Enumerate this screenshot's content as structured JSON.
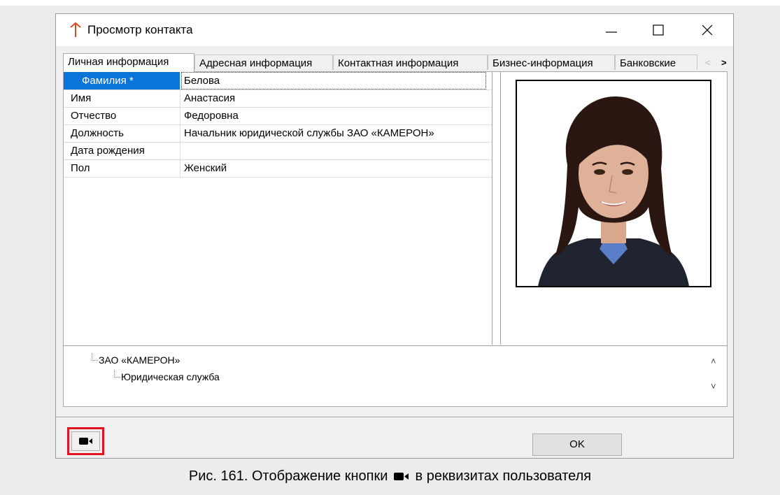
{
  "window": {
    "title": "Просмотр контакта",
    "accent_color": "#d84b20"
  },
  "tabs": [
    {
      "label": "Личная информация",
      "active": true
    },
    {
      "label": "Адресная информация",
      "active": false
    },
    {
      "label": "Контактная информация",
      "active": false
    },
    {
      "label": "Бизнес-информация",
      "active": false
    },
    {
      "label": "Банковские",
      "active": false
    }
  ],
  "tab_scroll": {
    "left_icon": "chevron-left-icon",
    "right_icon": "chevron-right-icon"
  },
  "fields": [
    {
      "name": "Фамилия *",
      "value": "Белова",
      "selected": true
    },
    {
      "name": "Имя",
      "value": "Анастасия"
    },
    {
      "name": "Отчество",
      "value": "Федоровна"
    },
    {
      "name": "Должность",
      "value": "Начальник юридической службы ЗАО «КАМЕРОН»"
    },
    {
      "name": "Дата рождения",
      "value": ""
    },
    {
      "name": "Пол",
      "value": "Женский"
    }
  ],
  "photo": {
    "icon": "contact-photo"
  },
  "tree": {
    "items": [
      "ЗАО «КАМЕРОН»",
      "Юридическая служба"
    ]
  },
  "buttons": {
    "video_icon": "video-camera-icon",
    "ok_label": "OK"
  },
  "highlight_color": "#e0141e",
  "caption": {
    "before": "Рис. 161. Отображение кнопки",
    "after": "в реквизитах пользователя"
  }
}
